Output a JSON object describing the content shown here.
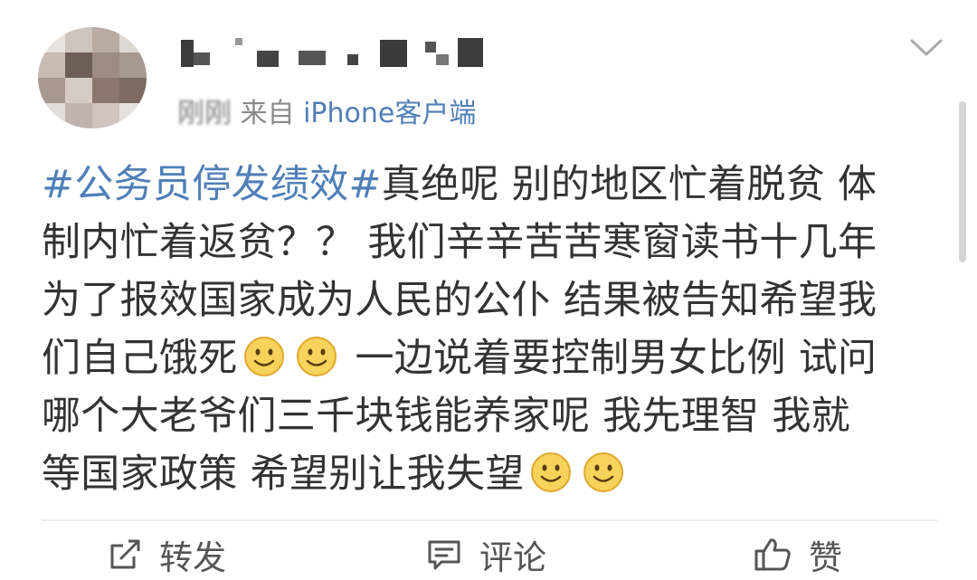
{
  "post": {
    "time_label": "刚刚",
    "source_prefix": "来自 ",
    "source_client": "iPhone客户端",
    "hashtag": "#公务员停发绩效#",
    "line1_rest": "真绝呢 别的地区忙着脱贫 体",
    "line2": "制内忙着返贫？？ 我们辛辛苦苦寒窗读书十几年",
    "line3": "为了报效国家成为人民的公仆 结果被告知希望我",
    "line4_a": "们自己饿死",
    "line4_b": " 一边说着要控制男女比例 试问",
    "line5": "哪个大老爷们三千块钱能养家呢 我先理智 我就",
    "line6": "等国家政策 希望别让我失望",
    "emoji": "smile-emoji"
  },
  "actions": {
    "repost_label": "转发",
    "comment_label": "评论",
    "like_label": "赞"
  },
  "colors": {
    "link": "#4f7fb8",
    "text": "#333333",
    "meta": "#8a8a8a"
  }
}
